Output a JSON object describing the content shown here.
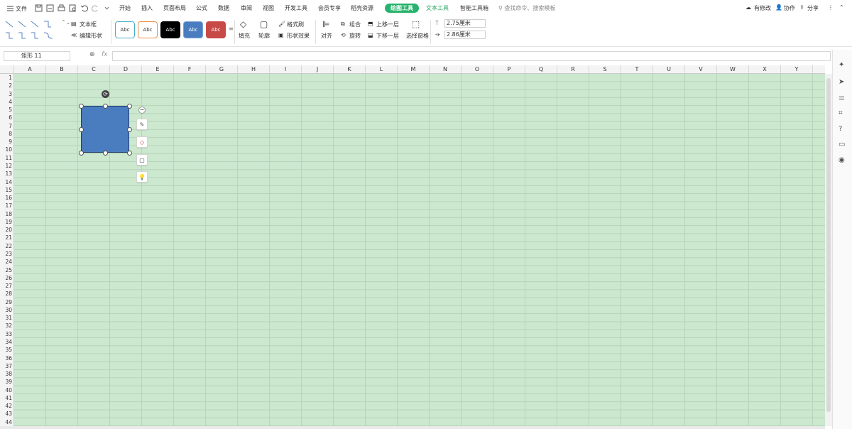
{
  "menu": {
    "file_label": "文件",
    "tabs": [
      "开始",
      "插入",
      "页面布局",
      "公式",
      "数据",
      "审阅",
      "视图",
      "开发工具",
      "会员专享",
      "稻壳资源"
    ],
    "active_tab": "绘图工具",
    "text_tool_tab": "文本工具",
    "smart_tab": "智能工具箱",
    "search_placeholder": "查找命令、搜索模板",
    "has_changes": "有修改",
    "collaborate": "协作",
    "share": "分享"
  },
  "ribbon": {
    "text_box": "文本框",
    "edit_shape": "编辑形状",
    "style_label": "Abc",
    "fill": "填充",
    "outline": "轮廓",
    "format_painter": "格式刷",
    "shape_effects": "形状效果",
    "align": "对齐",
    "group": "组合",
    "rotate": "旋转",
    "bring_forward": "上移一层",
    "send_backward": "下移一层",
    "selection_pane": "选择窗格",
    "height_value": "2.75厘米",
    "width_value": "2.86厘米"
  },
  "formula_bar": {
    "name_box": "矩形 11",
    "fx": "fx"
  },
  "grid": {
    "columns": [
      "A",
      "B",
      "C",
      "D",
      "E",
      "F",
      "G",
      "H",
      "I",
      "J",
      "K",
      "L",
      "M",
      "N",
      "O",
      "P",
      "Q",
      "R",
      "S",
      "T",
      "U",
      "V",
      "W",
      "X",
      "Y"
    ],
    "rows": [
      "1",
      "2",
      "3",
      "4",
      "5",
      "6",
      "7",
      "8",
      "9",
      "10",
      "11",
      "12",
      "13",
      "14",
      "15",
      "16",
      "17",
      "18",
      "19",
      "20",
      "21",
      "22",
      "23",
      "24",
      "25",
      "26",
      "27",
      "28",
      "29",
      "30",
      "31",
      "32",
      "33",
      "34",
      "35",
      "36",
      "37",
      "38",
      "39",
      "40",
      "41",
      "42",
      "43",
      "44"
    ]
  },
  "colors": {
    "sheet_bg": "#cce8cf",
    "shape_fill": "#4a7dbf",
    "accent_green": "#26b36b"
  }
}
